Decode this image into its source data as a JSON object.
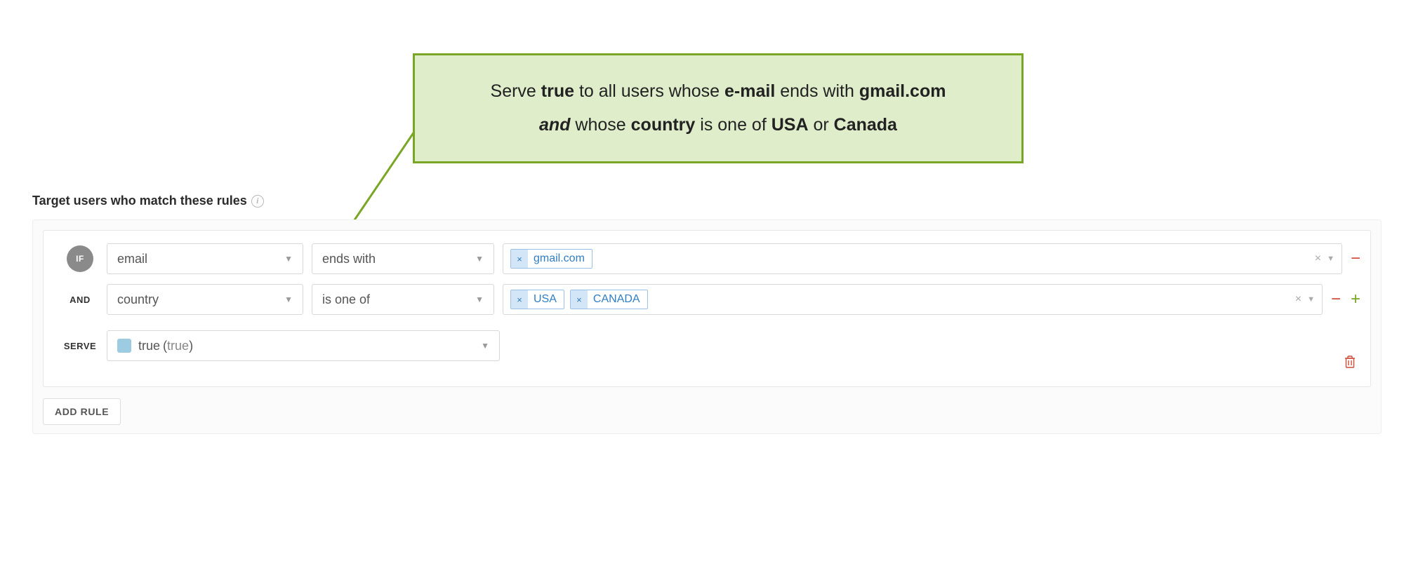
{
  "callout": {
    "parts": {
      "p1": "Serve ",
      "true": "true",
      "p2": " to all users whose ",
      "email": "e-mail",
      "p3": " ends with ",
      "gmail": "gmail.com",
      "and": " and ",
      "p4": "whose ",
      "country": "country",
      "p5": " is one of ",
      "usa": "USA",
      "p6": " or ",
      "canada": "Canada"
    }
  },
  "section": {
    "title": "Target users who match these rules"
  },
  "rule": {
    "clauses": [
      {
        "prefix": "IF",
        "attribute": "email",
        "operator": "ends with",
        "values": [
          "gmail.com"
        ],
        "showAdd": false
      },
      {
        "prefix": "AND",
        "attribute": "country",
        "operator": "is one of",
        "values": [
          "USA",
          "CANADA"
        ],
        "showAdd": true
      }
    ],
    "serve": {
      "label": "SERVE",
      "variation_label": "true",
      "variation_value": "true"
    }
  },
  "buttons": {
    "add_rule": "ADD RULE"
  },
  "icons": {
    "info": "i",
    "caret": "▼",
    "tag_remove": "×",
    "clear": "×",
    "minus": "−",
    "plus": "+"
  },
  "colors": {
    "callout_bg": "#dfedcb",
    "callout_border": "#79a625",
    "tag_border": "#9cc1e6",
    "tag_text": "#2f7ec4",
    "danger": "#d14a3a",
    "success": "#79a625",
    "swatch": "#9ccbe2"
  }
}
